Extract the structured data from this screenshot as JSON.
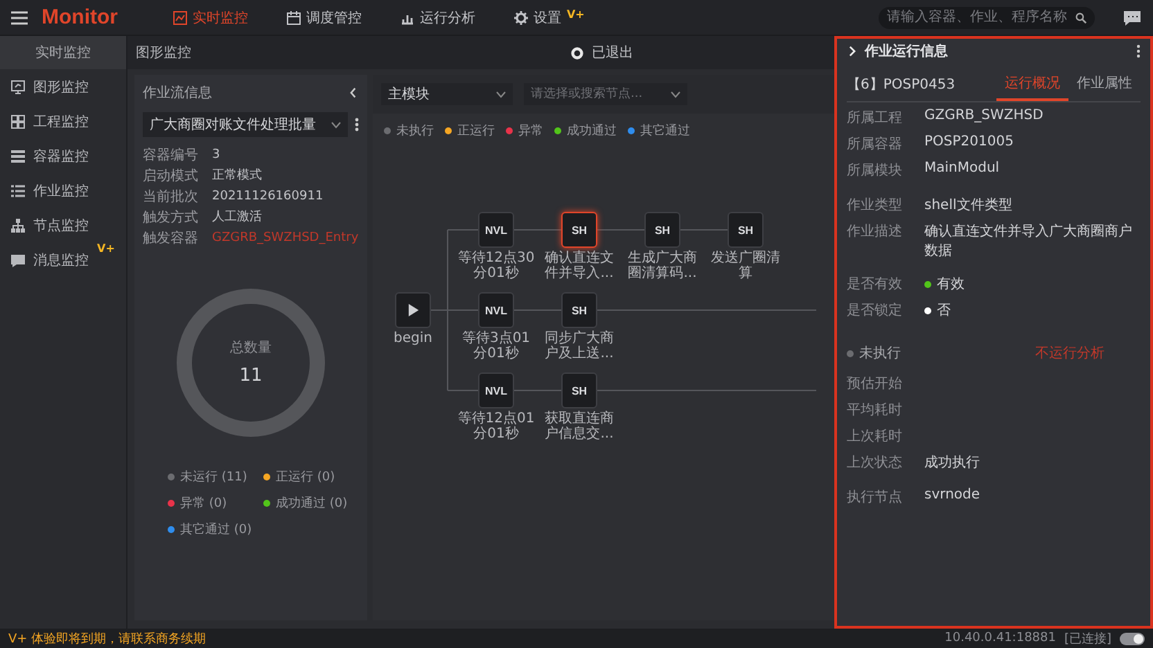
{
  "topbar": {
    "logo": "Monitor",
    "nav": [
      {
        "label": "实时监控",
        "selected": true
      },
      {
        "label": "调度管控",
        "selected": false
      },
      {
        "label": "运行分析",
        "selected": false
      },
      {
        "label": "设置",
        "badge": "V+",
        "selected": false
      }
    ],
    "search": {
      "placeholder": "请输入容器、作业、程序名称"
    }
  },
  "sidebar": {
    "title": "实时监控",
    "items": [
      {
        "label": "图形监控"
      },
      {
        "label": "工程监控"
      },
      {
        "label": "容器监控"
      },
      {
        "label": "作业监控"
      },
      {
        "label": "节点监控"
      },
      {
        "label": "消息监控",
        "badge": "V+"
      }
    ]
  },
  "breadcrumb": "图形监控",
  "connection_status": "已退出",
  "flow_panel": {
    "title": "作业流信息",
    "dropdown": "广大商圈对账文件处理批量",
    "fields": [
      {
        "label": "容器编号",
        "value": "3"
      },
      {
        "label": "启动模式",
        "value": "正常模式"
      },
      {
        "label": "当前批次",
        "value": "20211126160911"
      },
      {
        "label": "触发方式",
        "value": "人工激活"
      },
      {
        "label": "触发容器",
        "value": "GZGRB_SWZHSD_Entry",
        "kind": "link"
      }
    ],
    "total": {
      "label": "总数量",
      "value": "11"
    },
    "legend": [
      {
        "label": "未运行 (11)",
        "color": "#6b6c70"
      },
      {
        "label": "正运行 (0)",
        "color": "#f5a623"
      },
      {
        "label": "异常 (0)",
        "color": "#e8334a"
      },
      {
        "label": "成功通过 (0)",
        "color": "#52c41a"
      },
      {
        "label": "其它通过 (0)",
        "color": "#2f8ded"
      }
    ]
  },
  "canvas": {
    "module_select": "主模块",
    "node_search": {
      "placeholder": "请选择或搜索节点..."
    },
    "legend": [
      {
        "label": "未执行",
        "color": "#6b6c70"
      },
      {
        "label": "正运行",
        "color": "#f5a623"
      },
      {
        "label": "异常",
        "color": "#e8334a"
      },
      {
        "label": "成功通过",
        "color": "#52c41a"
      },
      {
        "label": "其它通过",
        "color": "#2f8ded"
      }
    ],
    "begin": {
      "label": "begin"
    },
    "branches": [
      [
        {
          "type": "NVL",
          "label": "等待12点30分01秒",
          "selected": false
        },
        {
          "type": "SH",
          "label": "确认直连文件并导入...",
          "selected": true
        },
        {
          "type": "SH",
          "label": "生成广大商圈清算码...",
          "selected": false
        },
        {
          "type": "SH",
          "label": "发送广圈清算",
          "selected": false
        }
      ],
      [
        {
          "type": "NVL",
          "label": "等待3点01分01秒",
          "selected": false
        },
        {
          "type": "SH",
          "label": "同步广大商户及上送...",
          "selected": false
        }
      ],
      [
        {
          "type": "NVL",
          "label": "等待12点01分01秒",
          "selected": false
        },
        {
          "type": "SH",
          "label": "获取直连商户信息交...",
          "selected": false
        }
      ]
    ]
  },
  "job_panel": {
    "title": "作业运行信息",
    "job_id": "【6】POSP0453",
    "tabs": [
      {
        "label": "运行概况",
        "selected": true
      },
      {
        "label": "作业属性",
        "selected": false
      }
    ],
    "fields": [
      {
        "label": "所属工程",
        "value": "GZGRB_SWZHSD"
      },
      {
        "label": "所属容器",
        "value": "POSP201005"
      },
      {
        "label": "所属模块",
        "value": "MainModul"
      },
      {
        "label": "作业类型",
        "value": "shell文件类型"
      },
      {
        "label": "作业描述",
        "value": "确认直连文件并导入广大商圈商户数据"
      },
      {
        "label": "是否有效",
        "value": "有效",
        "color": "#52c41a"
      },
      {
        "label": "是否锁定",
        "value": "否",
        "color": "#ffffff"
      }
    ],
    "run_status": {
      "label": "未执行",
      "color": "#6b6c70"
    },
    "analysis_link": "不运行分析",
    "run_fields": [
      {
        "label": "预估开始"
      },
      {
        "label": "平均耗时"
      },
      {
        "label": "上次耗时"
      },
      {
        "label": "上次状态",
        "value": "成功执行"
      },
      {
        "label": "执行节点",
        "value": "svrnode"
      }
    ]
  },
  "status_bar": {
    "notice": "V+ 体验即将到期，请联系商务续期",
    "server": "10.40.0.41:18881",
    "connection": "[已连接]",
    "toggle_on": true
  }
}
